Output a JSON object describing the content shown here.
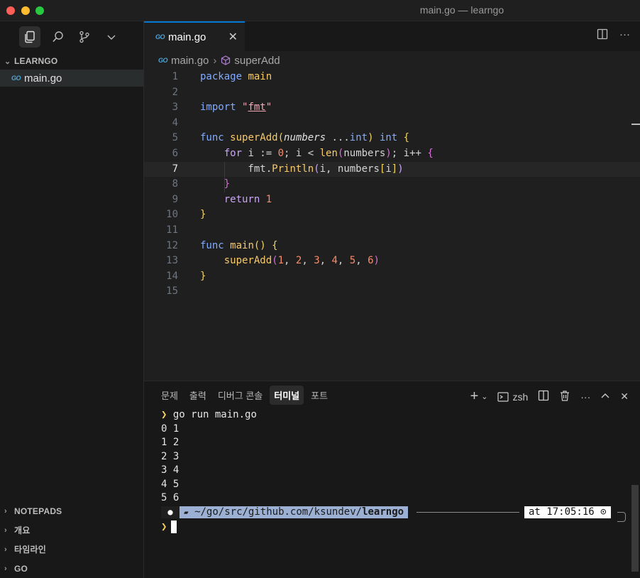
{
  "window": {
    "title": "main.go — learngo"
  },
  "sidebar": {
    "explorer_title": "LEARNGO",
    "files": [
      {
        "name": "main.go",
        "badge": "GO"
      }
    ],
    "bottom_sections": [
      "NOTEPADS",
      "개요",
      "타임라인",
      "GO"
    ]
  },
  "editor": {
    "tab": {
      "label": "main.go",
      "badge": "GO"
    },
    "breadcrumb": {
      "file": "main.go",
      "symbol": "superAdd"
    },
    "current_line": 7,
    "line_numbers": [
      "1",
      "2",
      "3",
      "4",
      "5",
      "6",
      "7",
      "8",
      "9",
      "10",
      "11",
      "12",
      "13",
      "14",
      "15"
    ]
  },
  "panel": {
    "tabs": [
      "문제",
      "출력",
      "디버그 콘솔",
      "터미널",
      "포트"
    ],
    "active_tab": "터미널",
    "shell_label": "zsh",
    "terminal": {
      "command": "go run main.go",
      "output": [
        "0 1",
        "1 2",
        "2 3",
        "3 4",
        "4 5",
        "5 6"
      ],
      "path_prefix": "~/go/src/github.com/ksundev/",
      "path_dir": "learngo",
      "time": "at 17:05:16"
    }
  },
  "colors": {
    "accent": "#0078d4",
    "keyword": "#cba6f7",
    "function": "#f7ca6b",
    "string": "#f5a9b8",
    "number": "#f78c6c"
  }
}
